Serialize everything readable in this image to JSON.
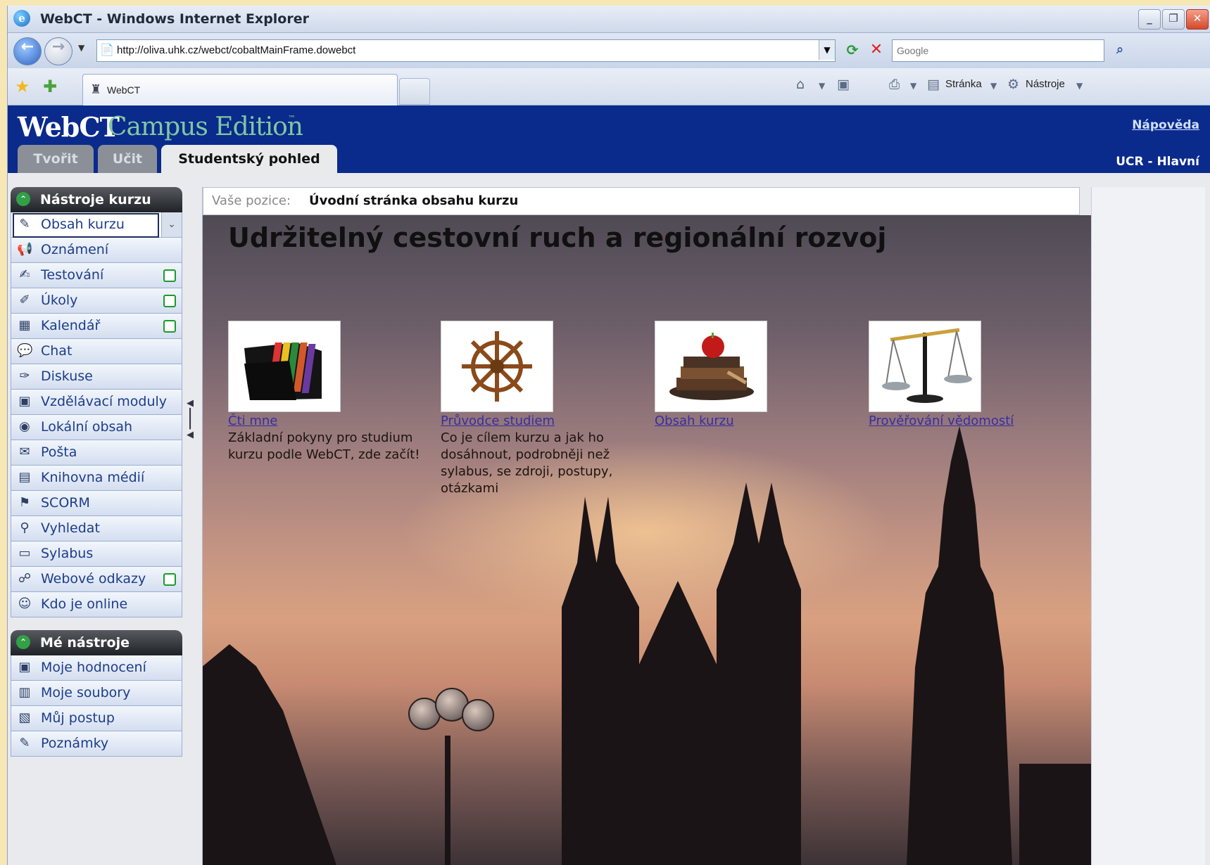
{
  "browser": {
    "window_title": "WebCT - Windows Internet Explorer",
    "url": "http://oliva.uhk.cz/webct/cobaltMainFrame.dowebct",
    "search_placeholder": "Google",
    "tab_label": "WebCT",
    "cmd_page": "Stránka",
    "cmd_tools": "Nástroje"
  },
  "header": {
    "brand": "WebCT",
    "edition": "Campus Edition",
    "trademark": "™",
    "tabs": [
      {
        "label": "Tvořit",
        "active": false
      },
      {
        "label": "Učit",
        "active": false
      },
      {
        "label": "Studentský pohled",
        "active": true
      }
    ],
    "help_link": "Nápověda",
    "institution": "UCR - Hlavní"
  },
  "sidebar": {
    "course_tools": {
      "title": "Nástroje kurzu",
      "items": [
        {
          "label": "Obsah kurzu",
          "icon": "course-content-icon",
          "selected": true
        },
        {
          "label": "Oznámení",
          "icon": "announcement-icon"
        },
        {
          "label": "Testování",
          "icon": "test-icon",
          "new": true
        },
        {
          "label": "Úkoly",
          "icon": "assignment-icon",
          "new": true
        },
        {
          "label": "Kalendář",
          "icon": "calendar-icon",
          "new": true
        },
        {
          "label": "Chat",
          "icon": "chat-icon"
        },
        {
          "label": "Diskuse",
          "icon": "discussion-icon"
        },
        {
          "label": "Vzdělávací moduly",
          "icon": "learning-module-icon"
        },
        {
          "label": "Lokální obsah",
          "icon": "local-content-icon"
        },
        {
          "label": "Pošta",
          "icon": "mail-icon"
        },
        {
          "label": "Knihovna médií",
          "icon": "media-library-icon"
        },
        {
          "label": "SCORM",
          "icon": "scorm-icon"
        },
        {
          "label": "Vyhledat",
          "icon": "search-icon"
        },
        {
          "label": "Sylabus",
          "icon": "syllabus-icon"
        },
        {
          "label": "Webové odkazy",
          "icon": "web-links-icon",
          "new": true
        },
        {
          "label": "Kdo je online",
          "icon": "who-online-icon"
        }
      ]
    },
    "my_tools": {
      "title": "Mé nástroje",
      "items": [
        {
          "label": "Moje hodnocení",
          "icon": "grades-icon"
        },
        {
          "label": "Moje soubory",
          "icon": "files-icon"
        },
        {
          "label": "Můj postup",
          "icon": "progress-icon"
        },
        {
          "label": "Poznámky",
          "icon": "notes-icon"
        }
      ]
    }
  },
  "main": {
    "breadcrumb_label": "Vaše pozice:",
    "breadcrumb_value": "Úvodní stránka obsahu kurzu",
    "course_title": "Udržitelný cestovní ruch a regionální rozvoj",
    "cards": [
      {
        "link": "Čti mne",
        "desc": "Základní pokyny pro studium kurzu podle WebCT, zde začít!",
        "icon": "folders-icon"
      },
      {
        "link": "Průvodce studiem",
        "desc": "Co je cílem kurzu a jak ho dosáhnout, podrobněji než sylabus, se zdroji, postupy, otázkami",
        "icon": "ship-wheel-icon"
      },
      {
        "link": "Obsah kurzu",
        "desc": "",
        "icon": "books-apple-icon"
      },
      {
        "link": "Prověřování vědomostí",
        "desc": "",
        "icon": "scales-icon"
      }
    ]
  },
  "colors": {
    "header_bg": "#0a2a8c",
    "brand_accent": "#7fc8a0",
    "link": "#3a2ea0",
    "new_badge": "#1c9a2c"
  }
}
